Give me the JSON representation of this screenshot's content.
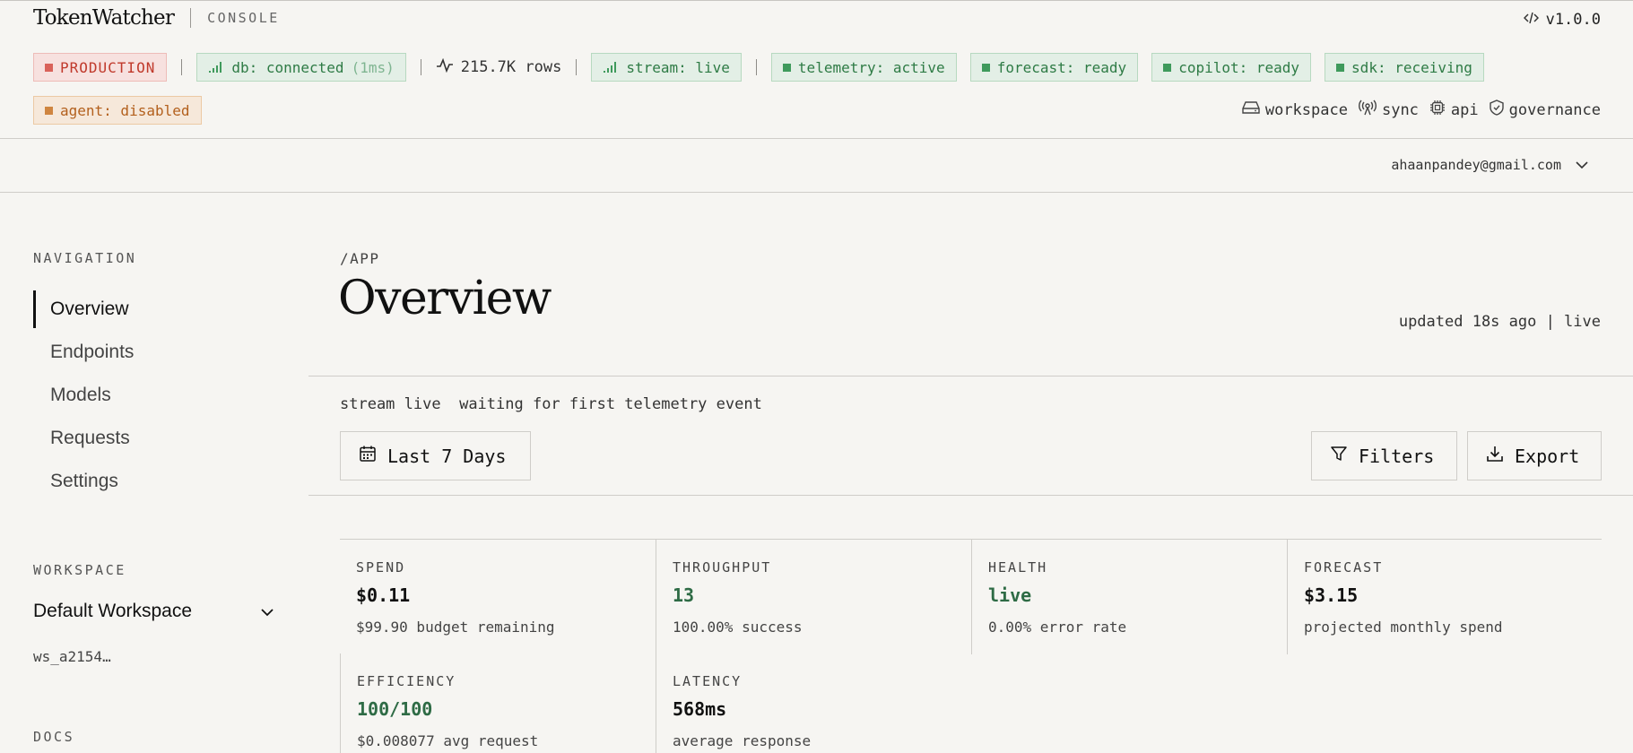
{
  "header": {
    "brand": "TokenWatcher",
    "brand_sub": "CONSOLE",
    "version": "v1.0.0",
    "version_icon": "code-icon"
  },
  "status": {
    "environment": "PRODUCTION",
    "db_label": "db: connected",
    "db_latency": "(1ms)",
    "rows": "215.7K rows",
    "stream": "stream: live",
    "telemetry": "telemetry: active",
    "forecast": "forecast: ready",
    "copilot": "copilot: ready",
    "sdk": "sdk: receiving",
    "agent": "agent: disabled"
  },
  "quick_links": [
    {
      "label": "workspace",
      "icon": "drive-icon"
    },
    {
      "label": "sync",
      "icon": "broadcast-icon"
    },
    {
      "label": "api",
      "icon": "chip-icon"
    },
    {
      "label": "governance",
      "icon": "shield-icon"
    }
  ],
  "user": {
    "email": "ahaanpandey@gmail.com"
  },
  "sidebar": {
    "navigation_label": "NAVIGATION",
    "items": [
      {
        "label": "Overview",
        "active": true
      },
      {
        "label": "Endpoints"
      },
      {
        "label": "Models"
      },
      {
        "label": "Requests"
      },
      {
        "label": "Settings"
      }
    ],
    "workspace_label": "WORKSPACE",
    "workspace_name": "Default Workspace",
    "workspace_id": "ws_a2154…",
    "docs_label": "DOCS"
  },
  "main": {
    "breadcrumb": "/APP",
    "title": "Overview",
    "updated": "updated 18s ago | live",
    "stream_status": "stream live",
    "stream_message": "waiting for first telemetry event",
    "date_range": "Last 7 Days",
    "filters": "Filters",
    "export": "Export"
  },
  "metrics": [
    {
      "label": "SPEND",
      "value": "$0.11",
      "sub": "$99.90 budget remaining",
      "accent": false
    },
    {
      "label": "THROUGHPUT",
      "value": "13",
      "sub": "100.00% success",
      "accent": true
    },
    {
      "label": "HEALTH",
      "value": "live",
      "sub": "0.00% error rate",
      "accent": true
    },
    {
      "label": "FORECAST",
      "value": "$3.15",
      "sub": "projected monthly spend",
      "accent": false
    },
    {
      "label": "EFFICIENCY",
      "value": "100/100",
      "sub": "$0.008077 avg request",
      "accent": true
    },
    {
      "label": "LATENCY",
      "value": "568ms",
      "sub": "average response",
      "accent": false
    }
  ],
  "colors": {
    "background": "#f6f5f2",
    "green_text": "#2e7b45",
    "red_text": "#c0392b",
    "amber_text": "#b3601d",
    "metric_green": "#2e6b45"
  }
}
